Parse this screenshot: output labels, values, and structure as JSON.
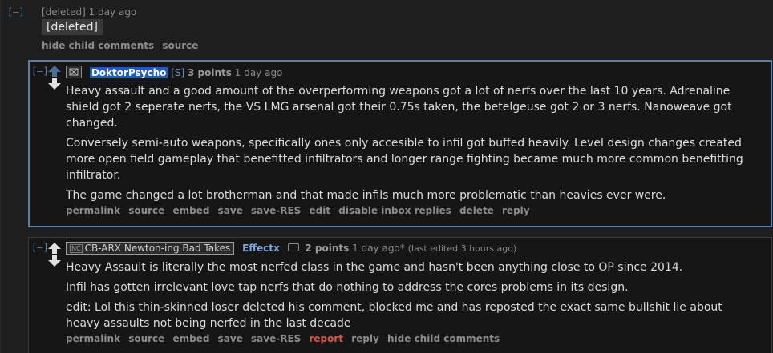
{
  "top_comment": {
    "toggle": "[–]",
    "author": "[deleted]",
    "time": "1 day ago",
    "body": "[deleted]",
    "buttons": [
      "hide child comments",
      "source"
    ]
  },
  "reply1": {
    "toggle": "[–]",
    "author": "DoktorPsycho",
    "submitter_tag": "[S]",
    "points": "3 points",
    "time": "1 day ago",
    "paragraphs": [
      "Heavy assault and a good amount of the overperforming weapons got a lot of nerfs over the last 10 years. Adrenaline shield got 2 seperate nerfs, the VS LMG arsenal got their 0.75s taken, the betelgeuse got 2 or 3 nerfs. Nanoweave got changed.",
      "Conversely semi-auto weapons, specifically ones only accesible to infil got buffed heavily. Level design changes created more open field gameplay that benefitted infiltrators and longer range fighting became much more common benefitting infiltrator.",
      "The game changed a lot brotherman and that made infils much more problematic than heavies ever were."
    ],
    "buttons": [
      "permalink",
      "source",
      "embed",
      "save",
      "save-RES",
      "edit",
      "disable inbox replies",
      "delete",
      "reply"
    ]
  },
  "reply2": {
    "toggle": "[–]",
    "flair_mini": "NC",
    "flair_text": "CB-ARX Newton-ing Bad Takes",
    "author": "Effectx",
    "points": "2 points",
    "time": "1 day ago*",
    "edited": "(last edited 3 hours ago)",
    "paragraphs": [
      "Heavy Assault is literally the most nerfed class in the game and hasn't been anything close to OP since 2014.",
      "Infil has gotten irrelevant love tap nerfs that do nothing to address the cores problems in its design.",
      "edit: Lol this thin-skinned loser deleted his comment, blocked me and has reposted the exact same bullshit lie about heavy assaults not being nerfed in the last decade"
    ],
    "buttons": [
      "permalink",
      "source",
      "embed",
      "save",
      "save-RES",
      "report",
      "reply",
      "hide child comments"
    ]
  },
  "colors": {
    "background": "#1e1e1f",
    "accent_border": "#5a7ea7",
    "author_highlight": "#1f5bbf",
    "upvote_active": "#5a7ea7",
    "report": "#d45a4a"
  }
}
